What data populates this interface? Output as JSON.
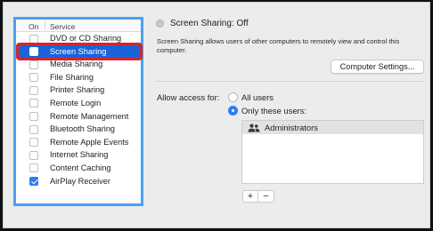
{
  "services": {
    "header_on": "On",
    "header_service": "Service",
    "items": [
      {
        "label": "DVD or CD Sharing",
        "checked": false,
        "selected": false
      },
      {
        "label": "Screen Sharing",
        "checked": false,
        "selected": true
      },
      {
        "label": "Media Sharing",
        "checked": false,
        "selected": false
      },
      {
        "label": "File Sharing",
        "checked": false,
        "selected": false
      },
      {
        "label": "Printer Sharing",
        "checked": false,
        "selected": false
      },
      {
        "label": "Remote Login",
        "checked": false,
        "selected": false
      },
      {
        "label": "Remote Management",
        "checked": false,
        "selected": false
      },
      {
        "label": "Bluetooth Sharing",
        "checked": false,
        "selected": false
      },
      {
        "label": "Remote Apple Events",
        "checked": false,
        "selected": false
      },
      {
        "label": "Internet Sharing",
        "checked": false,
        "selected": false
      },
      {
        "label": "Content Caching",
        "checked": false,
        "selected": false
      },
      {
        "label": "AirPlay Receiver",
        "checked": true,
        "selected": false
      }
    ]
  },
  "detail": {
    "status_text": "Screen Sharing: Off",
    "description": "Screen Sharing allows users of other computers to remotely view and control this computer.",
    "settings_button": "Computer Settings...",
    "access_label": "Allow access for:",
    "option_all": "All users",
    "option_only": "Only these users:",
    "selected_option": "only",
    "users": [
      {
        "name": "Administrators",
        "icon": "group-icon"
      }
    ],
    "add_label": "+",
    "remove_label": "−"
  },
  "colors": {
    "accent": "#2f7cf6",
    "selection": "#1a63d8",
    "panel_focus": "#4aa0f0",
    "highlight_outline": "#d4262d"
  }
}
